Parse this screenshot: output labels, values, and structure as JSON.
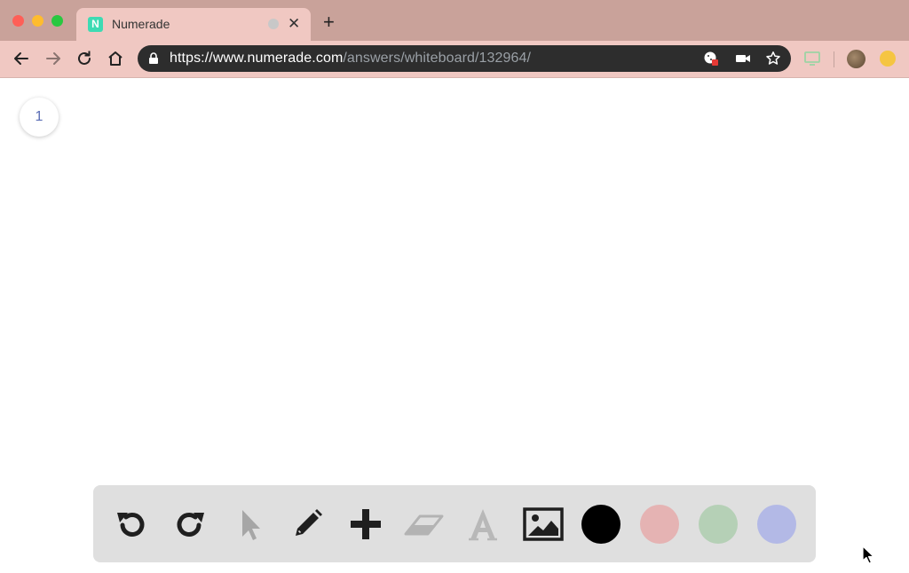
{
  "browser": {
    "tab_title": "Numerade",
    "favicon_letter": "N",
    "url_host": "https://www.numerade.com",
    "url_path": "/answers/whiteboard/132964/"
  },
  "whiteboard": {
    "page_number": "1",
    "tools": [
      "undo-icon",
      "redo-icon",
      "select-pointer-icon",
      "pencil-icon",
      "plus-icon",
      "eraser-icon",
      "text-icon",
      "image-icon"
    ],
    "colors": {
      "black": "#000000",
      "pink": "#e5b3b3",
      "green": "#b5d0b6",
      "blue": "#b3b9e6"
    }
  }
}
